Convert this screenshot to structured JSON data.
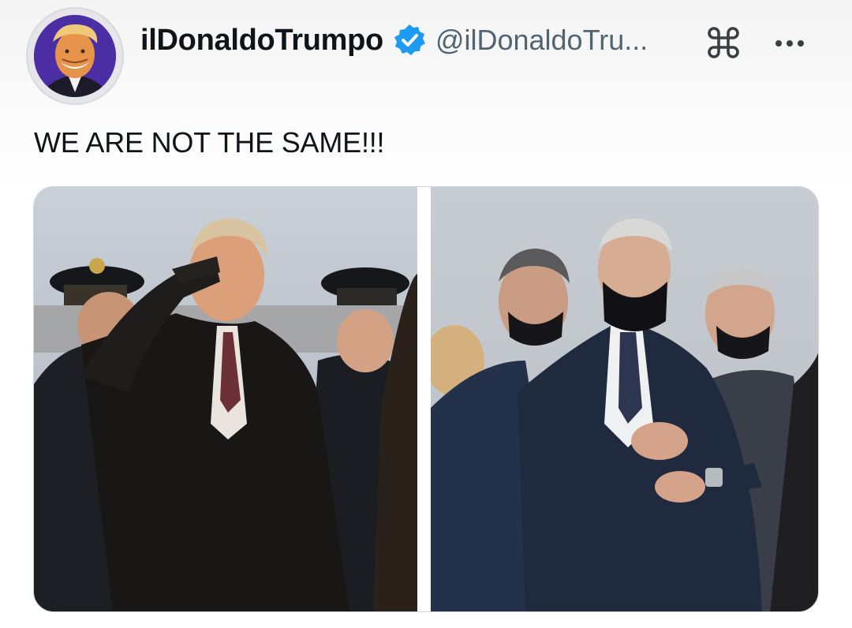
{
  "post": {
    "display_name": "ilDonaldoTrumpo",
    "handle": "@ilDonaldoTru...",
    "text": "WE ARE NOT THE SAME!!!"
  },
  "icons": {
    "verified": "verified-badge-icon",
    "command": "command-key-icon",
    "more": "more-options-icon"
  },
  "colors": {
    "verified_badge": "#1d9bf0",
    "name_text": "#0f1419",
    "handle_text": "#536471"
  },
  "media": {
    "images": [
      {
        "alt": "Man in dark overcoat saluting beside honor guard officers"
      },
      {
        "alt": "Man in dark suit and black face mask looking at his wristwatch among officials"
      }
    ]
  }
}
